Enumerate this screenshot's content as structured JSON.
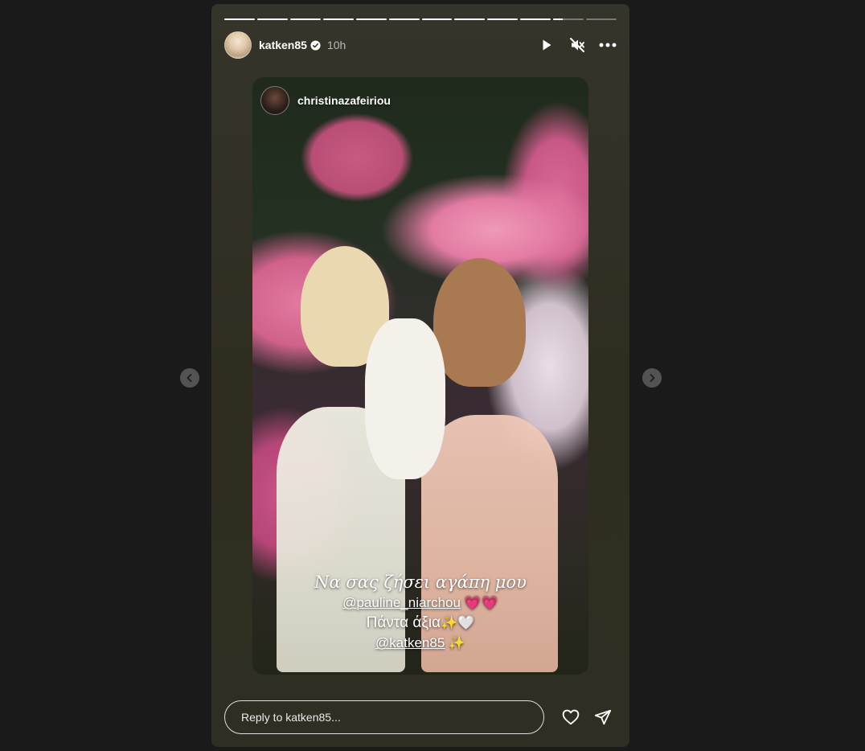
{
  "story": {
    "username": "katken85",
    "time_ago": "10h",
    "verified": true,
    "progress": {
      "segments_total": 12,
      "segments_complete": 10,
      "current_segment_fraction": 0.3
    },
    "header_icons": [
      "play-icon",
      "muted-speaker-icon",
      "more-options-icon"
    ]
  },
  "media": {
    "reposted_from": "christinazafeiriou",
    "caption": {
      "line1": "Να σας ζήσει αγάπη μου",
      "mention1": "@pauline_niarchou",
      "emoji1": "💗💗",
      "line3": "Πάντα άξια",
      "emoji3": "✨🤍",
      "mention2": "@katken85",
      "emoji4": "✨"
    }
  },
  "reply": {
    "placeholder": "Reply to katken85..."
  },
  "icons": {
    "like": "heart-icon",
    "share": "send-icon",
    "prev": "chevron-left-icon",
    "next": "chevron-right-icon"
  },
  "colors": {
    "background": "#1a1a1a",
    "card": "#2f2e22",
    "accent_pink": "#ff4fb3"
  }
}
